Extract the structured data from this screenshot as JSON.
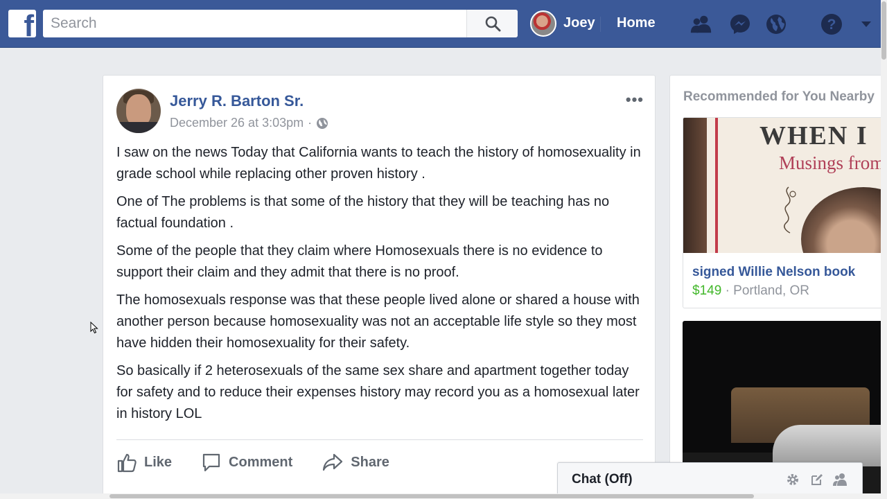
{
  "topbar": {
    "logo": "f",
    "search_placeholder": "Search",
    "user_name": "Joey",
    "home_label": "Home",
    "brand_color": "#3b5998",
    "icons": [
      "friend-requests-icon",
      "messenger-icon",
      "notifications-globe-icon",
      "help-icon",
      "account-menu-caret-icon"
    ]
  },
  "post": {
    "author": "Jerry R. Barton Sr.",
    "timestamp": "December 26 at 3:03pm",
    "separator": "·",
    "more": "•••",
    "paragraphs": [
      "I saw on the news Today that California wants to teach the history of homosexuality in grade school while replacing other proven history .",
      "One of The problems is that some of the history that they will be teaching has no factual foundation .",
      "Some of the people that they claim where Homosexuals there is no evidence to support their claim and they admit that there is no proof.",
      "The homosexuals response was that these people lived alone or shared a house with another person because homosexuality was not an acceptable life style so they most have hidden their homosexuality for their safety.",
      "So basically if 2 heterosexuals of the same sex share and apartment together today for safety and to reduce their expenses history may record you as a homosexual later in history LOL"
    ],
    "actions": {
      "like": "Like",
      "comment": "Comment",
      "share": "Share"
    }
  },
  "sidebar": {
    "title": "Recommended for You Nearby",
    "items": [
      {
        "name": "signed Willie Nelson book",
        "price": "$149",
        "dot": "·",
        "location": "Portland, OR",
        "image_text_1": "WHEN I",
        "image_text_2": "Musings from t"
      }
    ]
  },
  "chat": {
    "label": "Chat (Off)",
    "icons": [
      "settings-gear-icon",
      "new-message-icon",
      "create-group-icon"
    ]
  }
}
